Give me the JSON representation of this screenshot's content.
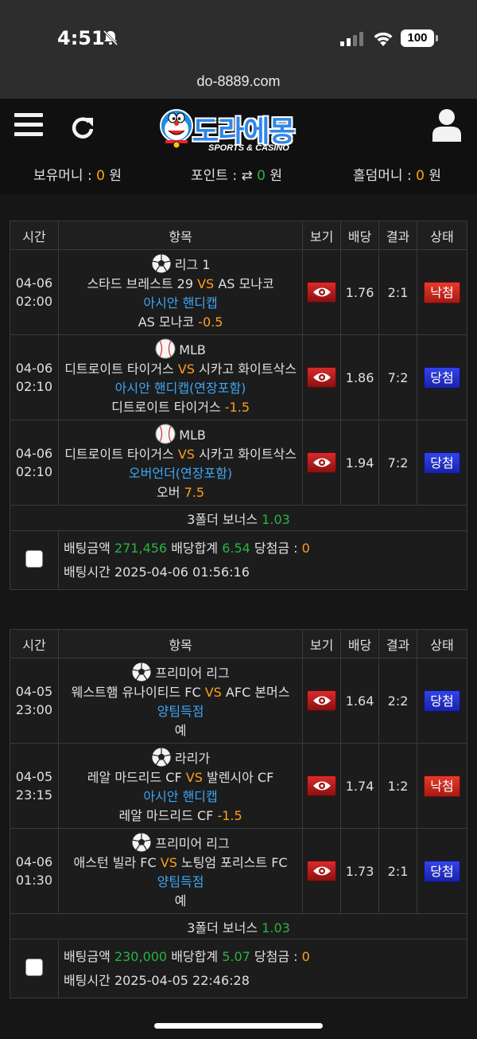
{
  "status_bar": {
    "time": "4:51",
    "battery": "100"
  },
  "url": "do-8889.com",
  "header": {
    "logo_text": "도라에몽",
    "logo_sub": "SPORTS & CASINO",
    "balance": {
      "money_label": "보유머니 :",
      "money_value": "0",
      "money_unit": "원",
      "points_label": "포인트 :",
      "points_value": "0",
      "points_unit": "원",
      "holdem_label": "홀덤머니 :",
      "holdem_value": "0",
      "holdem_unit": "원"
    }
  },
  "columns": [
    "시간",
    "항목",
    "보기",
    "배당",
    "결과",
    "상태"
  ],
  "slips": [
    {
      "games": [
        {
          "date": "04-06",
          "time": "02:00",
          "sport": "soccer",
          "league": "리그 1",
          "home": "스타드 브레스트 29",
          "vs": "VS",
          "away": "AS 모나코",
          "market": "아시안 핸디캡",
          "pick": "AS 모나코",
          "pick_val": "-0.5",
          "odds": "1.76",
          "result": "2:1",
          "status": "낙첨",
          "status_type": "lose"
        },
        {
          "date": "04-06",
          "time": "02:10",
          "sport": "baseball",
          "league": "MLB",
          "home": "디트로이트 타이거스",
          "vs": "VS",
          "away": "시카고 화이트삭스",
          "market": "아시안 핸디캡(연장포함)",
          "pick": "디트로이트 타이거스",
          "pick_val": "-1.5",
          "odds": "1.86",
          "result": "7:2",
          "status": "당첨",
          "status_type": "win"
        },
        {
          "date": "04-06",
          "time": "02:10",
          "sport": "baseball",
          "league": "MLB",
          "home": "디트로이트 타이거스",
          "vs": "VS",
          "away": "시카고 화이트삭스",
          "market": "오버언더(연장포함)",
          "pick": "오버",
          "pick_val": "7.5",
          "odds": "1.94",
          "result": "7:2",
          "status": "당첨",
          "status_type": "win"
        }
      ],
      "bonus_label": "3폴더 보너스",
      "bonus_value": "1.03",
      "bet_amount_label": "배팅금액",
      "bet_amount": "271,456",
      "odds_total_label": "배당합계",
      "odds_total": "6.54",
      "win_amount_label": "당첨금 :",
      "win_amount": "0",
      "bet_time_label": "배팅시간",
      "bet_time": "2025-04-06 01:56:16"
    },
    {
      "games": [
        {
          "date": "04-05",
          "time": "23:00",
          "sport": "soccer",
          "league": "프리미어 리그",
          "home": "웨스트햄 유나이티드 FC",
          "vs": "VS",
          "away": "AFC 본머스",
          "market": "양팀득점",
          "pick": "예",
          "pick_val": "",
          "odds": "1.64",
          "result": "2:2",
          "status": "당첨",
          "status_type": "win"
        },
        {
          "date": "04-05",
          "time": "23:15",
          "sport": "soccer",
          "league": "라리가",
          "home": "레알 마드리드 CF",
          "vs": "VS",
          "away": "발렌시아 CF",
          "market": "아시안 핸디캡",
          "pick": "레알 마드리드 CF",
          "pick_val": "-1.5",
          "odds": "1.74",
          "result": "1:2",
          "status": "낙첨",
          "status_type": "lose"
        },
        {
          "date": "04-06",
          "time": "01:30",
          "sport": "soccer",
          "league": "프리미어 리그",
          "home": "애스턴 빌라 FC",
          "vs": "VS",
          "away": "노팅엄 포리스트 FC",
          "market": "양팀득점",
          "pick": "예",
          "pick_val": "",
          "odds": "1.73",
          "result": "2:1",
          "status": "당첨",
          "status_type": "win"
        }
      ],
      "bonus_label": "3폴더 보너스",
      "bonus_value": "1.03",
      "bet_amount_label": "배팅금액",
      "bet_amount": "230,000",
      "odds_total_label": "배당합계",
      "odds_total": "5.07",
      "win_amount_label": "당첨금 :",
      "win_amount": "0",
      "bet_time_label": "배팅시간",
      "bet_time": "2025-04-05 22:46:28"
    }
  ]
}
